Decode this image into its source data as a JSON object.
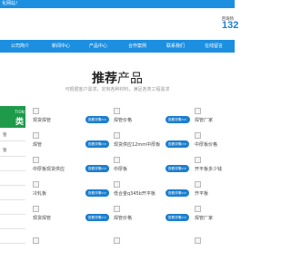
{
  "topbar": {
    "text": "化网站！"
  },
  "hotline": {
    "label": "咨询热",
    "number": "132"
  },
  "nav": {
    "items": [
      "公司简介",
      "新闻中心",
      "产品中心",
      "合作案例",
      "联系我们",
      "在线留言"
    ]
  },
  "section": {
    "title_bold": "推荐",
    "title_rest": "产品",
    "subtitle": "可根据客户需求，定制各种材料，满足各类工程需求"
  },
  "sidebar": {
    "title_en": "TION",
    "title_cn": "类",
    "items": [
      "管",
      "管",
      "",
      "",
      "",
      "",
      "",
      ""
    ]
  },
  "products": [
    {
      "name": "现货焊管",
      "button": "查看详情>>"
    },
    {
      "name": "焊管价格",
      "button": "查看详情>>"
    },
    {
      "name": "焊管厂家",
      "button": "查看详情>>"
    },
    {
      "name": "焊管",
      "button": "查看详情>>"
    },
    {
      "name": "现货供应12mm中厚板",
      "button": "查看详情>>"
    },
    {
      "name": "中厚板价格",
      "button": "查看详情>>"
    },
    {
      "name": "中厚板现货供应",
      "button": "查看详情>>"
    },
    {
      "name": "中厚板",
      "button": "查看详情>>"
    },
    {
      "name": "开平板多少钱",
      "button": "查看详情>>"
    },
    {
      "name": "冷轧板",
      "button": "查看详情>>"
    },
    {
      "name": "低合金q345b开平板",
      "button": "查看详情>>"
    },
    {
      "name": "开平板",
      "button": "查看详情>>"
    },
    {
      "name": "现货焊管",
      "button": "查看详情>>"
    },
    {
      "name": "焊管价格",
      "button": "查看详情>>"
    },
    {
      "name": "焊管厂家",
      "button": "查看详情>>"
    }
  ],
  "colors": {
    "primary_blue": "#1c8fe0",
    "button_blue": "#1c7fd0",
    "sidebar_green": "#1e9a4a"
  }
}
